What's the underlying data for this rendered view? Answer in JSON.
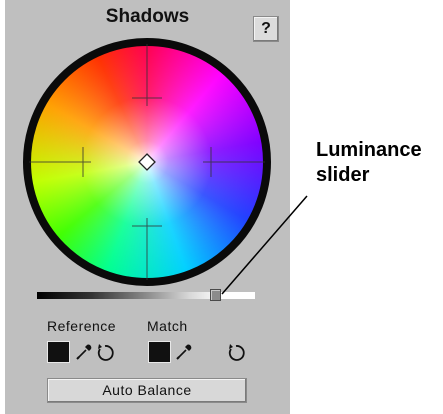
{
  "panel": {
    "title": "Shadows",
    "help_label": "?",
    "wheel": {
      "icon": "color-wheel",
      "rim_color": "#0a0a0a",
      "center_marker": "diamond"
    },
    "luminance": {
      "value": 0.82
    },
    "reference_label": "Reference",
    "match_label": "Match",
    "reference_swatch_color": "#111111",
    "match_swatch_color": "#111111",
    "tools": {
      "reference_picker_icon": "eyedropper-icon",
      "reference_reset_icon": "reset-icon",
      "match_picker_icon": "eyedropper-icon",
      "match_reset_icon": "reset-icon"
    },
    "auto_balance_label": "Auto Balance"
  },
  "callout": {
    "line1": "Luminance",
    "line2": "slider"
  }
}
